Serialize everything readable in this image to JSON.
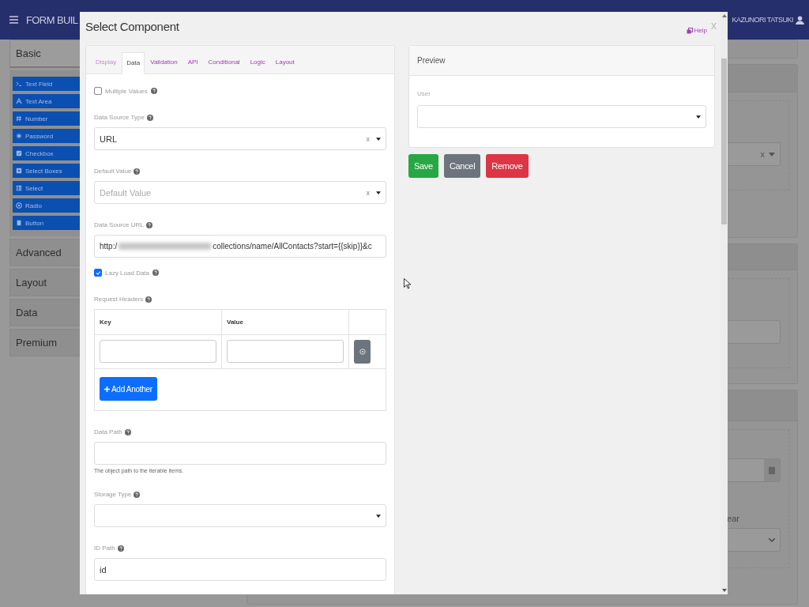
{
  "header": {
    "brand": "FORM BUIL",
    "user": "KAZUNORI TATSUKI"
  },
  "sidebar": {
    "groups": [
      {
        "title": "Basic",
        "expanded": true,
        "items": [
          "Text Field",
          "Text Area",
          "Number",
          "Password",
          "Checkbox",
          "Select Boxes",
          "Select",
          "Radio",
          "Button"
        ]
      },
      {
        "title": "Advanced",
        "expanded": false
      },
      {
        "title": "Layout",
        "expanded": false
      },
      {
        "title": "Data",
        "expanded": false
      },
      {
        "title": "Premium",
        "expanded": false
      }
    ]
  },
  "background": {
    "select_clear": "x",
    "field_label": "ear"
  },
  "modal": {
    "title": "Select Component",
    "help": "Help",
    "close": "x",
    "tabs": [
      {
        "label": "Display",
        "selected": false
      },
      {
        "label": "Data",
        "selected": true
      },
      {
        "label": "Validation",
        "selected": false
      },
      {
        "label": "API",
        "selected": false
      },
      {
        "label": "Conditional",
        "selected": false
      },
      {
        "label": "Logic",
        "selected": false
      },
      {
        "label": "Layout",
        "selected": false
      }
    ],
    "fields": [
      {
        "kind": "checkbox",
        "label": "Multiple Values",
        "checked": false
      },
      {
        "kind": "select",
        "label": "Data Source Type",
        "value": "URL",
        "clear": "x"
      },
      {
        "kind": "select",
        "label": "Default Value",
        "placeholder": "Default Value",
        "clear": "x"
      },
      {
        "kind": "url",
        "label": "Data Source URL",
        "value_start": "http:/",
        "value_end": "collections/name/AllContacts?start={{skip}}&c"
      },
      {
        "kind": "checkbox",
        "label": "Lazy Load Data",
        "checked": true
      },
      {
        "kind": "datagrid",
        "label": "Request Headers",
        "columns": [
          "Key",
          "Value"
        ],
        "add_button": "Add Another"
      },
      {
        "kind": "input",
        "label": "Data Path",
        "description": "The object path to the iterable items."
      },
      {
        "kind": "select",
        "label": "Storage Type"
      },
      {
        "kind": "input",
        "label": "ID Path",
        "value": "id"
      }
    ],
    "preview": {
      "title": "Preview",
      "field_label": "User"
    },
    "buttons": [
      {
        "label": "Save",
        "kind": "success"
      },
      {
        "label": "Cancel",
        "kind": "secondary"
      },
      {
        "label": "Remove",
        "kind": "danger"
      }
    ]
  }
}
